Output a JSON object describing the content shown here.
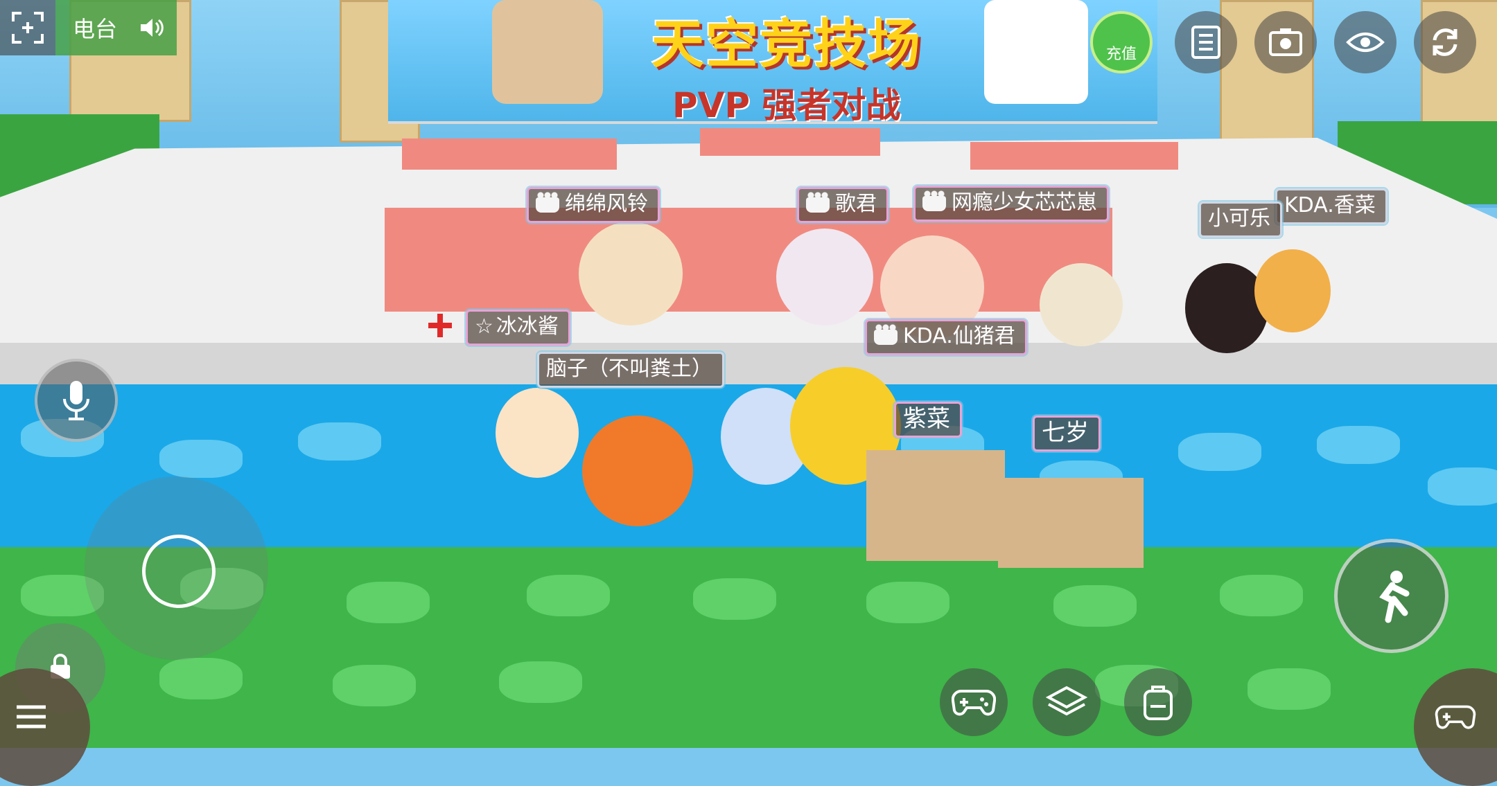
{
  "scene": {
    "banner_title": "天空竞技场",
    "banner_subtitle": "PVP 强者对战"
  },
  "hud": {
    "radio_label": "电台",
    "recharge_label": "充值",
    "icons": {
      "screenshot_frame": "fullscreen-frame-icon",
      "speaker": "speaker-icon",
      "list": "list-icon",
      "camera": "camera-icon",
      "eye": "eye-icon",
      "refresh": "refresh-icon",
      "mic": "mic-icon",
      "jump": "jump-icon",
      "gamepad": "gamepad-icon",
      "layers": "layers-icon",
      "backpack": "backpack-icon",
      "menu": "menu-icon",
      "lock": "lock-icon"
    }
  },
  "players": [
    {
      "name": "绵绵风铃"
    },
    {
      "name": "歌君"
    },
    {
      "name": "网瘾少女芯芯崽"
    },
    {
      "name": "KDA.香菜"
    },
    {
      "name": "小可乐"
    },
    {
      "name": "冰冰酱"
    },
    {
      "name": "KDA.仙猪君"
    },
    {
      "name": "脑子（不叫粪土）"
    },
    {
      "name": "紫菜"
    },
    {
      "name": "七岁"
    }
  ],
  "colors": {
    "grass": "#3fb54a",
    "water": "#1aa8e8",
    "platform": "#f0f0f0",
    "tag_border": "#e7a4d6"
  }
}
